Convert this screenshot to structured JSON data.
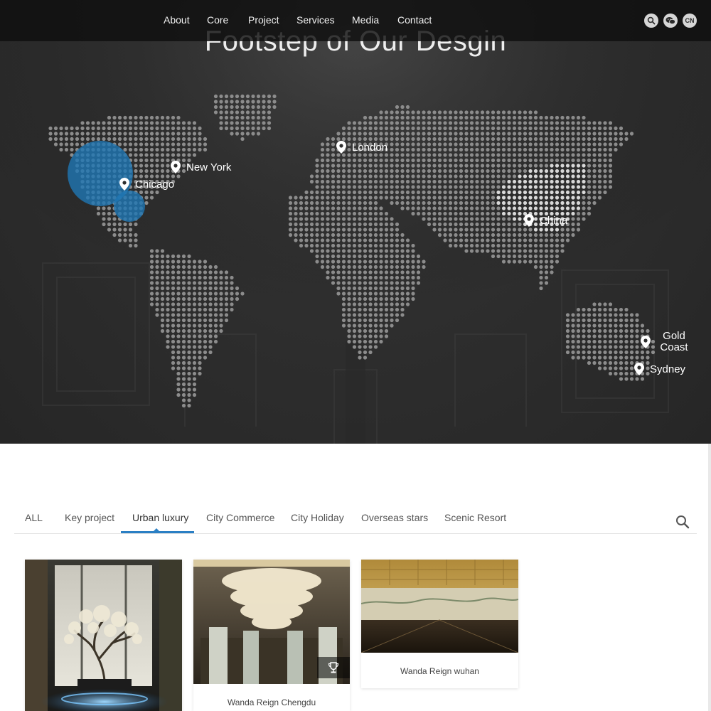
{
  "nav": {
    "links": [
      "About",
      "Core",
      "Project",
      "Services",
      "Media",
      "Contact"
    ],
    "icons": {
      "search": "search-icon",
      "wechat": "wechat-icon",
      "language": "CN"
    }
  },
  "hero": {
    "title": "Footstep of Our Desgin",
    "locations": [
      "New York",
      "Chicago",
      "London",
      "China",
      "Gold Coast",
      "Sydney"
    ],
    "colors": {
      "background": "#2e2e2e",
      "dots": "#8c8c8c",
      "highlight_dots": "#d8d8d8",
      "bubble": "#1f77b4"
    }
  },
  "tabs": {
    "items": [
      "ALL",
      "Key project",
      "Urban luxury",
      "City Commerce",
      "City Holiday",
      "Overseas stars",
      "Scenic Resort"
    ],
    "active": "Urban luxury",
    "accent": "#2a7fc4"
  },
  "projects": [
    {
      "caption": ""
    },
    {
      "caption": "Wanda Reign Chengdu",
      "badge": "trophy-icon"
    },
    {
      "caption": "Wanda Reign wuhan"
    }
  ]
}
